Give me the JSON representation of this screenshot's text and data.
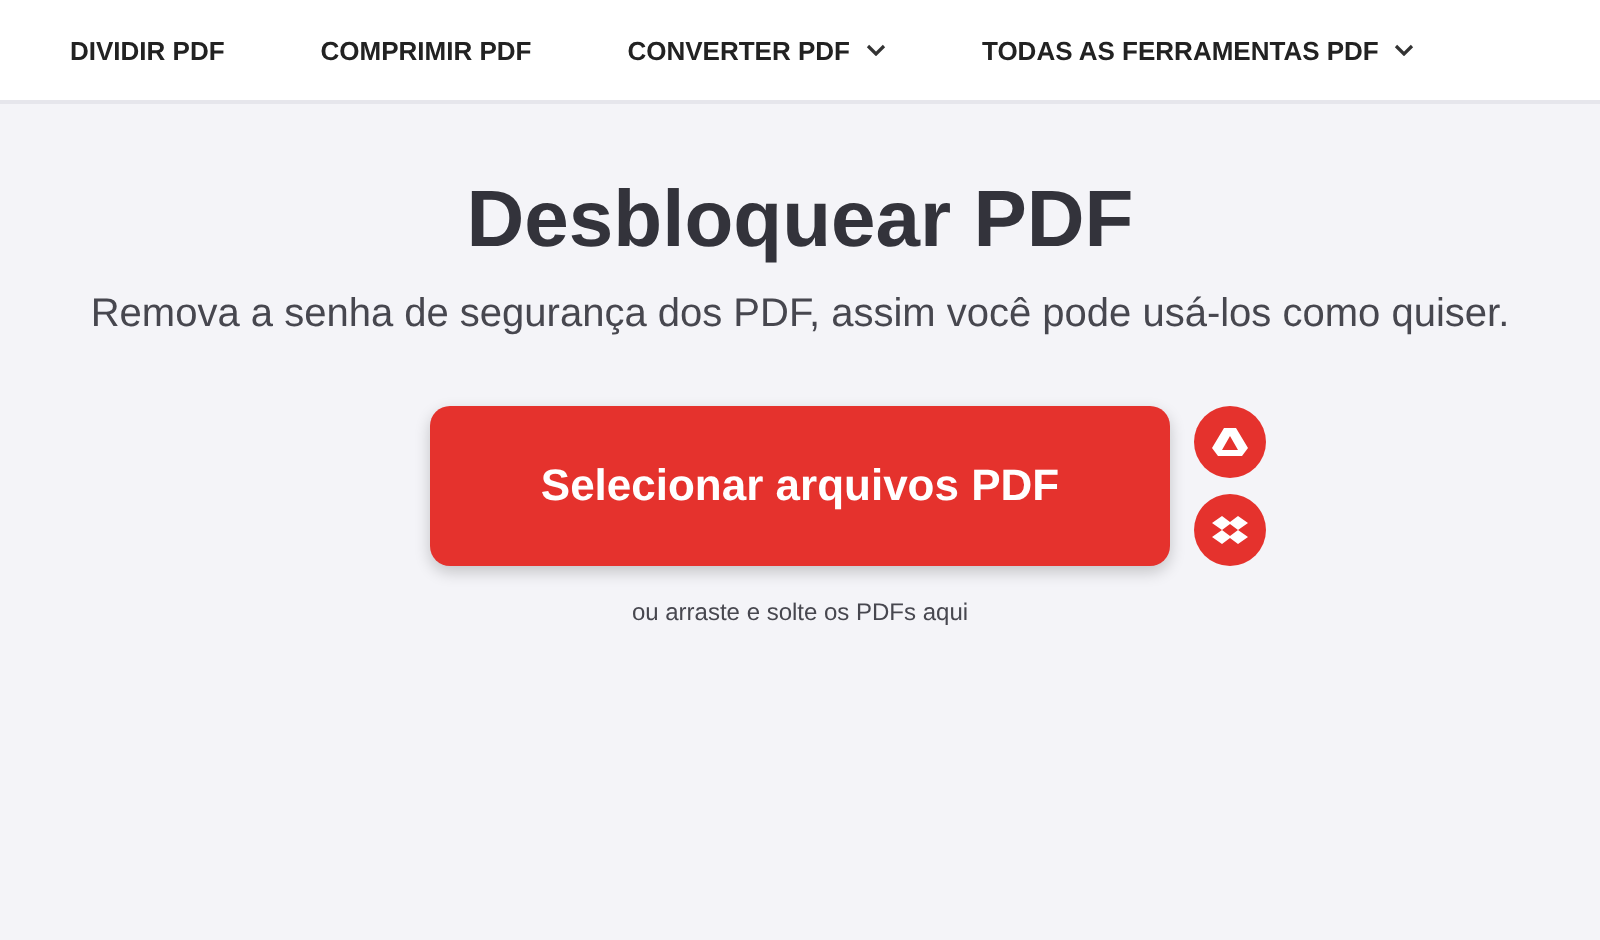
{
  "nav": [
    {
      "label": "DIVIDIR PDF",
      "dropdown": false
    },
    {
      "label": "COMPRIMIR PDF",
      "dropdown": false
    },
    {
      "label": "CONVERTER PDF",
      "dropdown": true
    },
    {
      "label": "TODAS AS FERRAMENTAS PDF",
      "dropdown": true
    }
  ],
  "title": "Desbloquear PDF",
  "subtitle": "Remova a senha de segurança dos PDF, assim você pode usá-los como quiser.",
  "upload_button": "Selecionar arquivos PDF",
  "cloud_sources": [
    {
      "kind": "drive"
    },
    {
      "kind": "dropbox"
    }
  ],
  "drop_hint": "ou arraste e solte os PDFs aqui"
}
